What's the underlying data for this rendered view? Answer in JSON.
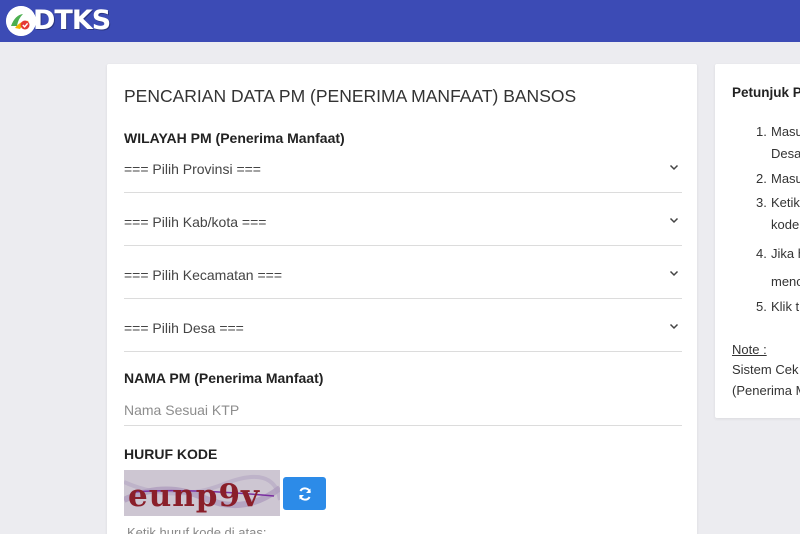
{
  "header": {
    "logo_text": "DTKS",
    "brand_color": "#3c4bb5"
  },
  "form": {
    "title": "PENCARIAN DATA PM (PENERIMA MANFAAT) BANSOS",
    "wilayah_label": "WILAYAH PM (Penerima Manfaat)",
    "selects": [
      {
        "selected": "=== Pilih Provinsi ==="
      },
      {
        "selected": "=== Pilih Kab/kota ==="
      },
      {
        "selected": "=== Pilih Kecamatan ==="
      },
      {
        "selected": "=== Pilih Desa ==="
      }
    ],
    "nama_label": "NAMA PM (Penerima Manfaat)",
    "nama_value": "",
    "nama_placeholder": "Nama Sesuai KTP",
    "kode_label": "HURUF KODE",
    "captcha_text": "eunp9v",
    "kode_hint": "Ketik huruf kode di atas:",
    "refresh_icon": "refresh-icon",
    "button_color": "#2c8be8"
  },
  "sidebar": {
    "title": "Petunjuk P",
    "steps": [
      {
        "num": "1.",
        "line1": "Masu",
        "line2": "Desa"
      },
      {
        "num": "2.",
        "line1": "Masu",
        "line2": ""
      },
      {
        "num": "3.",
        "line1": "Ketik",
        "line2": "kode"
      },
      {
        "num": "4.",
        "line1": "Jika h",
        "line2": "menc"
      },
      {
        "num": "5.",
        "line1": "Klik t",
        "line2": ""
      }
    ],
    "note_label": "Note :",
    "note_line1": "Sistem Cek",
    "note_line2": "(Penerima M"
  }
}
